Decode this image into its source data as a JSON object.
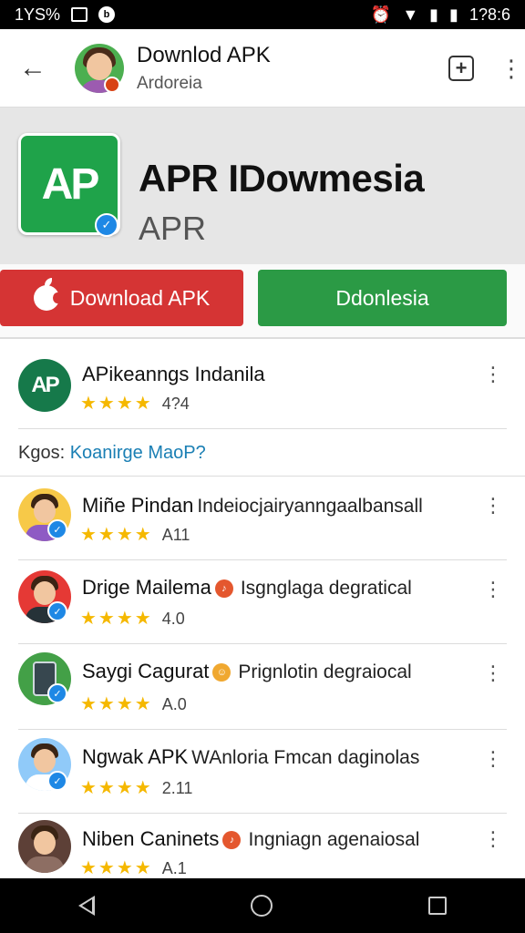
{
  "status_bar": {
    "left_text": "1YS%",
    "time": "1?8:6"
  },
  "app_bar": {
    "title": "Downlod APK",
    "subtitle": "Ardoreia"
  },
  "hero": {
    "icon_text": "AP",
    "title": "APR IDowmesia",
    "subtitle": "APR"
  },
  "buttons": {
    "download_label": "Download APK",
    "secondary_label": "Ddonlesia"
  },
  "featured": {
    "icon_text": "AP",
    "title": "APikeanngs Indanila",
    "stars": "★★★★",
    "rating": "4?4"
  },
  "kgos": {
    "prefix": "Kgos:",
    "link": "Koanirge MaoP?"
  },
  "list": [
    {
      "name": "Miñe Pindan",
      "desc": "Indeiocjairyanngaalbansall",
      "stars": "★★★★",
      "rating": "A11",
      "avatar_bg": "#f7c948",
      "shirt": "#8e5bc4"
    },
    {
      "name": "Drige Mailema",
      "desc": "Isgnglaga degratical",
      "stars": "★★★★",
      "rating": "4.0",
      "avatar_bg": "#e53935",
      "shirt": "#263238"
    },
    {
      "name": "Saygi Cagurat",
      "desc": "Prignlotin degraiocal",
      "stars": "★★★★",
      "rating": "A.0",
      "avatar_bg": "#43a047",
      "shirt": "#37474f"
    },
    {
      "name": "Ngwak APK",
      "desc": "WAnloria Fmcan daginolas",
      "stars": "★★★★",
      "rating": "2.11",
      "avatar_bg": "#90caf9",
      "shirt": "#ffffff"
    },
    {
      "name": "Niben Caninets",
      "desc": "Ingniagn agenaiosal",
      "stars": "★★★★",
      "rating": "A.1",
      "avatar_bg": "#5d4037",
      "shirt": "#8d6e63"
    }
  ],
  "colors": {
    "download_red": "#d53434",
    "secondary_green": "#2b9a45",
    "star_yellow": "#f5b800",
    "link_blue": "#1a7fb4"
  }
}
